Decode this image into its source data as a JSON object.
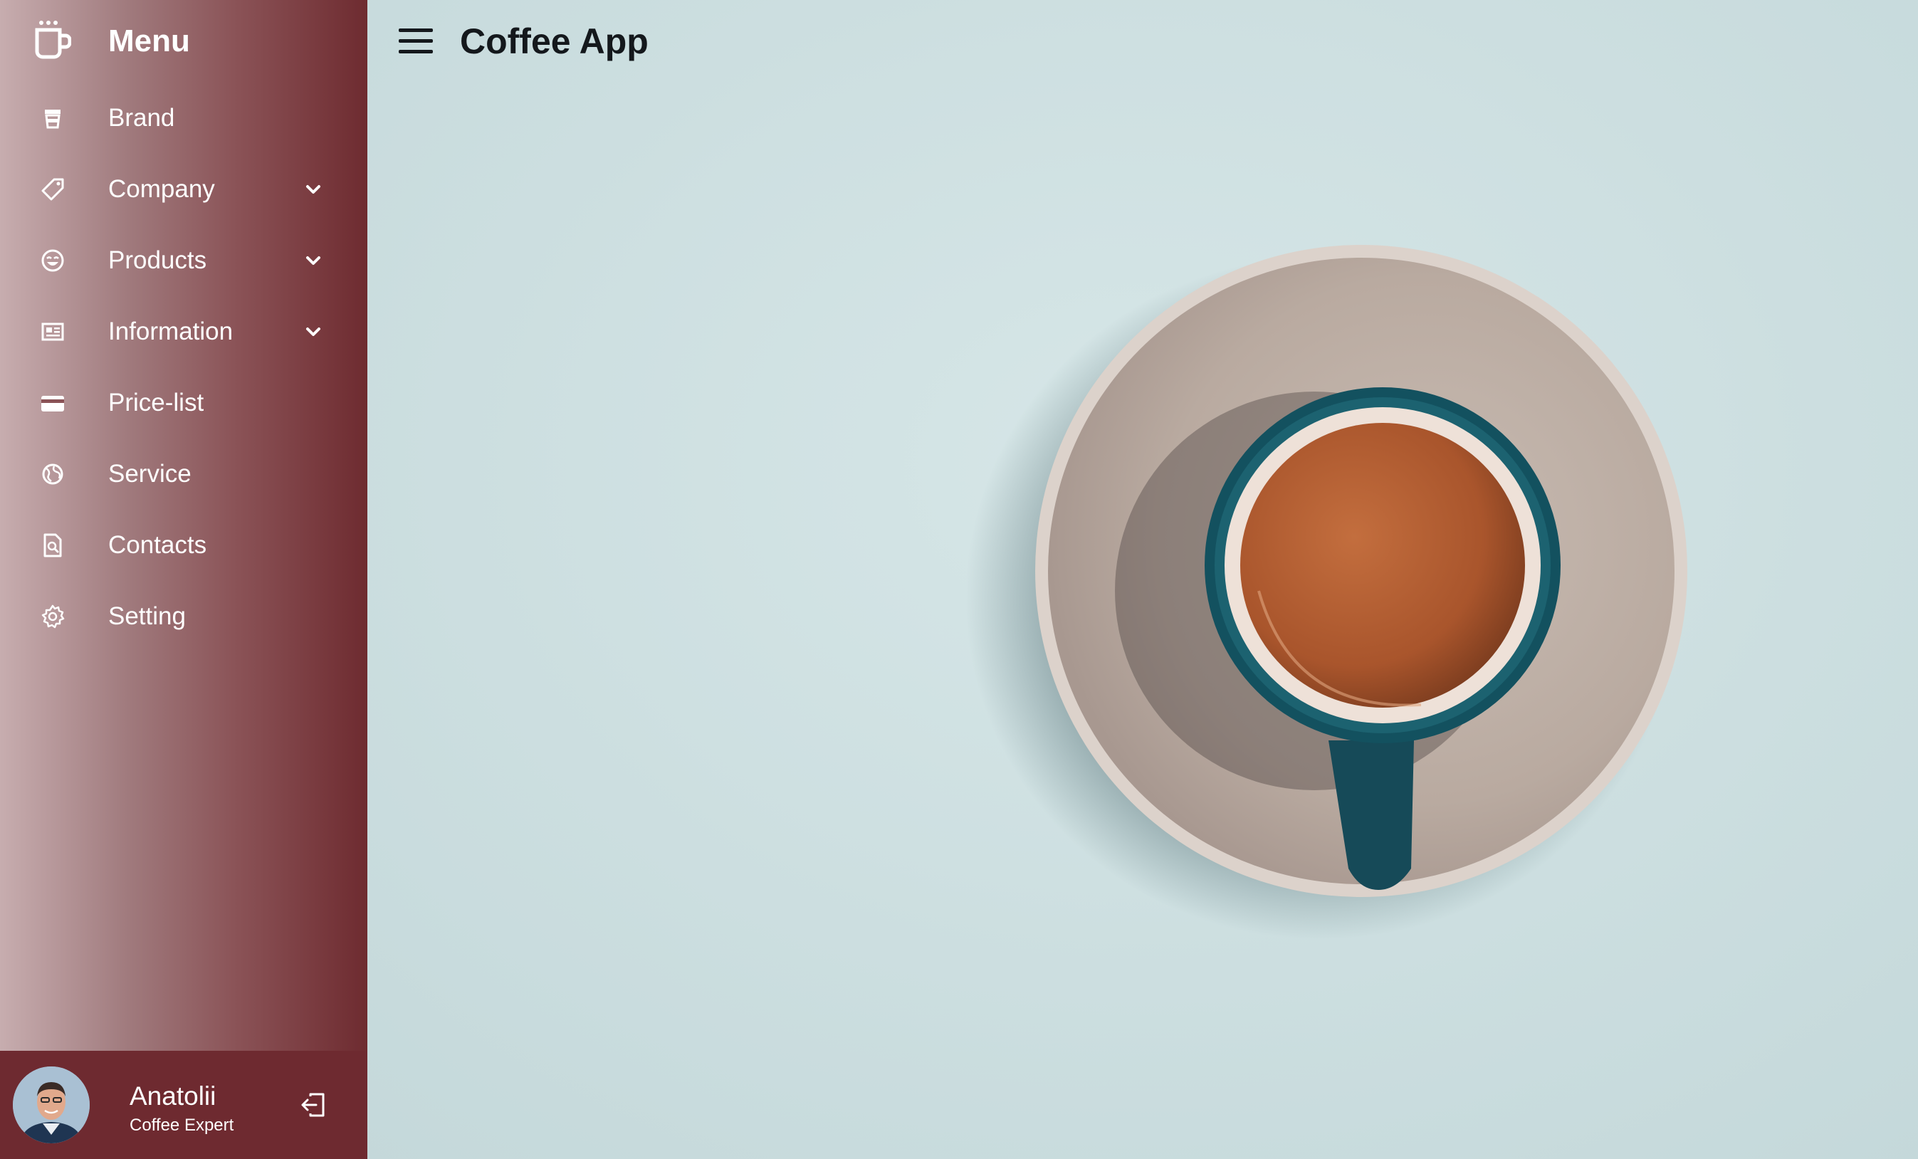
{
  "sidebar": {
    "title": "Menu",
    "logo_icon": "coffee-cup-icon",
    "items": [
      {
        "label": "Brand",
        "icon": "cup-icon",
        "has_submenu": false
      },
      {
        "label": "Company",
        "icon": "tag-icon",
        "has_submenu": true
      },
      {
        "label": "Products",
        "icon": "smile-icon",
        "has_submenu": true
      },
      {
        "label": "Information",
        "icon": "newspaper-icon",
        "has_submenu": true
      },
      {
        "label": "Price-list",
        "icon": "card-icon",
        "has_submenu": false
      },
      {
        "label": "Service",
        "icon": "globe-icon",
        "has_submenu": false
      },
      {
        "label": "Contacts",
        "icon": "document-search-icon",
        "has_submenu": false
      },
      {
        "label": "Setting",
        "icon": "gear-icon",
        "has_submenu": false
      }
    ]
  },
  "profile": {
    "name": "Anatolii",
    "role": "Coffee Expert",
    "logout_icon": "logout-icon"
  },
  "header": {
    "title": "Coffee App",
    "menu_icon": "hamburger-icon"
  },
  "colors": {
    "sidebar_dark": "#6e2b30",
    "sidebar_light": "#c7adaf",
    "background": "#cfe0e1",
    "title_text": "#14181c"
  }
}
